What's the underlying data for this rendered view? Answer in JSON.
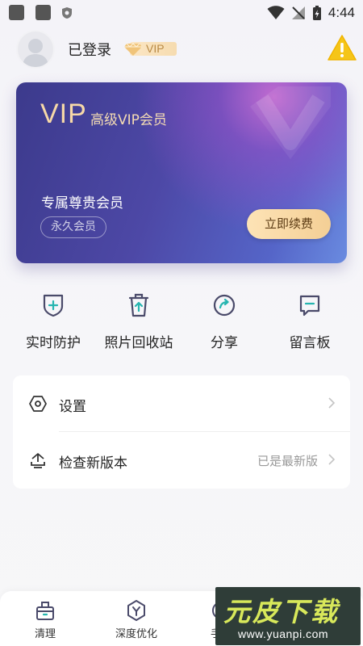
{
  "status_bar": {
    "time": "4:44",
    "icons": [
      "app-icon",
      "app-icon",
      "shield-icon",
      "wifi-icon",
      "signal-off-icon",
      "battery-charging-icon"
    ]
  },
  "header": {
    "username": "已登录",
    "vip_badge": "VIP",
    "alert_icon": "warning-icon"
  },
  "vip_card": {
    "vip_text": "VIP",
    "level": "高级VIP会员",
    "exclusive": "专属尊贵会员",
    "membership_type": "永久会员",
    "renew_button": "立即续费"
  },
  "quick_actions": [
    {
      "label": "实时防护",
      "icon": "shield-plus-icon"
    },
    {
      "label": "照片回收站",
      "icon": "trash-restore-icon"
    },
    {
      "label": "分享",
      "icon": "share-icon"
    },
    {
      "label": "留言板",
      "icon": "message-board-icon"
    }
  ],
  "settings": [
    {
      "label": "设置",
      "icon": "hexagon-settings-icon",
      "value": ""
    },
    {
      "label": "检查新版本",
      "icon": "upload-update-icon",
      "value": "已是最新版"
    }
  ],
  "bottom_nav": [
    {
      "label": "清理",
      "icon": "clean-box-icon"
    },
    {
      "label": "深度优化",
      "icon": "optimize-icon"
    },
    {
      "label": "手机",
      "icon": "phone-icon"
    }
  ],
  "watermark": {
    "title": "元皮下载",
    "url": "www.yuanpi.com"
  },
  "colors": {
    "card_start": "#3c3a8c",
    "card_end": "#6a8be0",
    "gold": "#f7d9a8",
    "accent_teal": "#26b5b0",
    "warning": "#f5c518"
  }
}
